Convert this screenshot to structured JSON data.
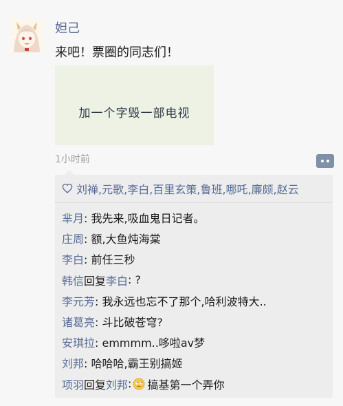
{
  "post": {
    "author": "妲己",
    "text": "来吧！票圈的同志们！",
    "image_caption": "加一个字毁一部电视",
    "time": "1小时前"
  },
  "likes": {
    "names": [
      "刘禅",
      "元歌",
      "李白",
      "百里玄策",
      "鲁班",
      "哪吒",
      "廉颇",
      "赵云"
    ],
    "separator": ","
  },
  "comments": [
    {
      "author": "芈月",
      "text": ": 我先来,吸血鬼日记者。"
    },
    {
      "author": "庄周",
      "text": ": 额,大鱼炖海棠"
    },
    {
      "author": "李白",
      "text": ": 前任三秒"
    },
    {
      "author": "韩信",
      "reply_word": "回复",
      "reply_to": "李白",
      "text": ": ?"
    },
    {
      "author": "李元芳",
      "text": ": 我永远也忘不了那个,哈利波特大.."
    },
    {
      "author": "诸葛亮",
      "text": ": 斗比破苍穹?"
    },
    {
      "author": "安琪拉",
      "text": ": emmmm..哆啦av梦"
    },
    {
      "author": "刘邦",
      "text": ": 哈哈哈,霸王别搞姬"
    },
    {
      "author": "项羽",
      "reply_word": "回复",
      "reply_to": "刘邦",
      "text": ":",
      "emoji": "rolling-eyes-emoji",
      "text_after": "搞基第一个弄你"
    }
  ],
  "colors": {
    "name_link": "#576b95",
    "background": "#f7f7f7",
    "comment_panel": "#ededed"
  }
}
